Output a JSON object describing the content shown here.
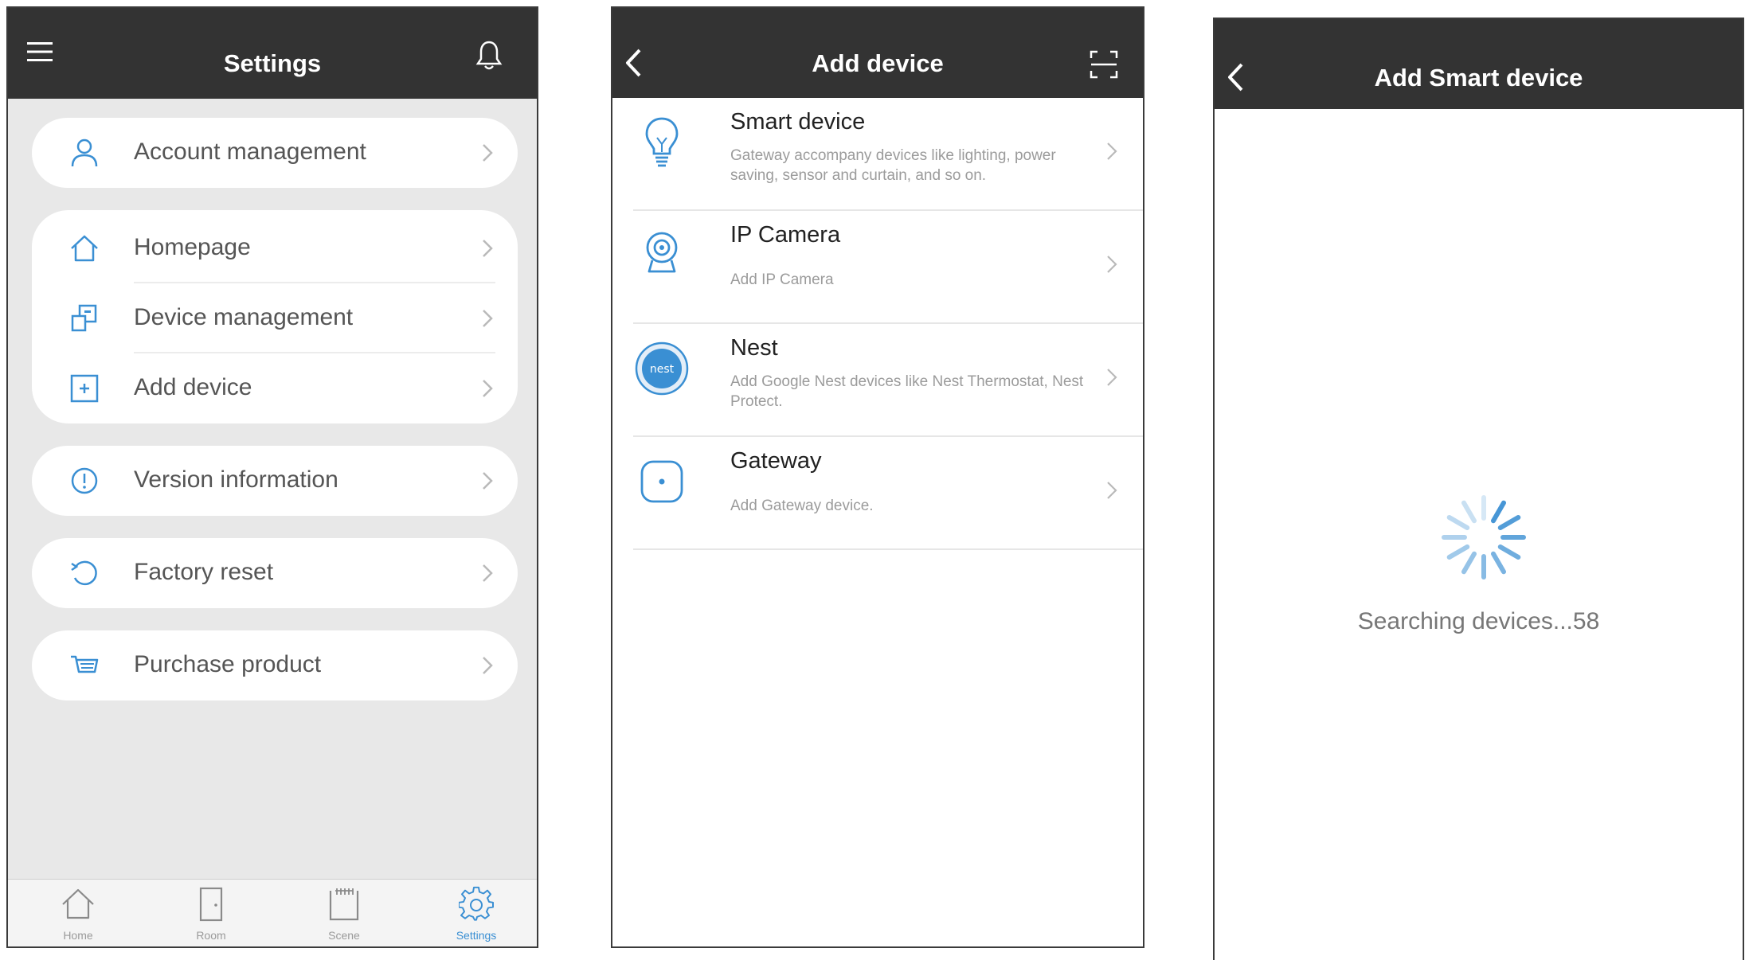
{
  "settings_screen": {
    "title": "Settings",
    "groups": [
      [
        {
          "label": "Account management",
          "icon": "person-icon"
        }
      ],
      [
        {
          "label": "Homepage",
          "icon": "home-icon"
        },
        {
          "label": "Device management",
          "icon": "device-management-icon"
        },
        {
          "label": "Add device",
          "icon": "add-box-icon"
        }
      ],
      [
        {
          "label": "Version information",
          "icon": "info-icon"
        }
      ],
      [
        {
          "label": "Factory reset",
          "icon": "reset-icon"
        }
      ],
      [
        {
          "label": "Purchase product",
          "icon": "cart-icon"
        }
      ]
    ],
    "tabs": [
      {
        "label": "Home",
        "icon": "home-icon",
        "active": false
      },
      {
        "label": "Room",
        "icon": "door-icon",
        "active": false
      },
      {
        "label": "Scene",
        "icon": "scene-icon",
        "active": false
      },
      {
        "label": "Settings",
        "icon": "gear-icon",
        "active": true
      }
    ]
  },
  "add_device_screen": {
    "title": "Add device",
    "items": [
      {
        "title": "Smart device",
        "description": "Gateway accompany devices like lighting, power saving, sensor and curtain, and so on.",
        "icon": "lightbulb-icon"
      },
      {
        "title": "IP Camera",
        "description": "Add IP Camera",
        "icon": "camera-icon"
      },
      {
        "title": "Nest",
        "description": "Add Google Nest devices like Nest Thermostat, Nest Protect.",
        "icon": "nest-icon",
        "icon_text": "nest"
      },
      {
        "title": "Gateway",
        "description": "Add Gateway device.",
        "icon": "gateway-icon"
      }
    ]
  },
  "add_smart_device_screen": {
    "title": "Add Smart device",
    "status": "Searching devices...58"
  },
  "colors": {
    "header": "#333333",
    "accent": "#3a8fd3",
    "background_gray": "#e8e8e8"
  }
}
